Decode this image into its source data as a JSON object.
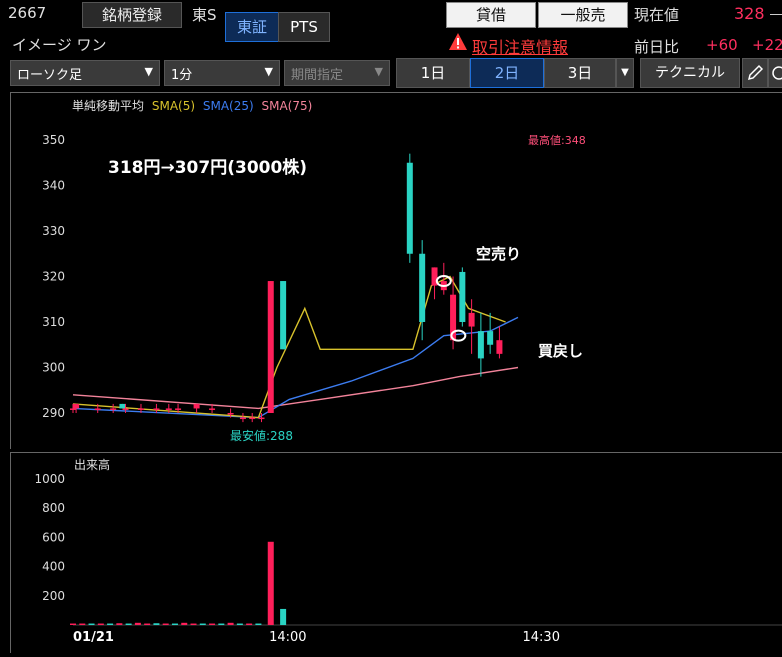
{
  "header": {
    "code": "2667",
    "name": "イメージ ワン",
    "register_label": "銘柄登録",
    "market_short": "東S",
    "tab_tse": "東証",
    "tab_pts": "PTS",
    "btn_lend": "貸借",
    "btn_general": "一般売",
    "warning": "取引注意情報",
    "price_label": "現在値",
    "price": "328",
    "change_label": "前日比",
    "change": "+60",
    "change_pct": "+22"
  },
  "toolbar": {
    "chart_type": "ローソク足",
    "interval": "1分",
    "period": "期間指定",
    "day1": "1日",
    "day2": "2日",
    "day3": "3日",
    "technical": "テクニカル"
  },
  "colors": {
    "up": "#ff1f5a",
    "down": "#2ad4c4",
    "sma5": "#d8c22c",
    "sma25": "#3c7cf0",
    "sma75": "#f2839a",
    "accent": "#1e6fd9"
  },
  "chart_data": [
    {
      "type": "candlestick",
      "title": "単純移動平均",
      "legend": [
        "SMA(5)",
        "SMA(25)",
        "SMA(75)"
      ],
      "ylim": [
        285,
        355
      ],
      "yticks": [
        290,
        300,
        310,
        320,
        330,
        340,
        350
      ],
      "xlim": [
        0,
        144
      ],
      "grid": false,
      "annotations": {
        "main_text": "318円→307円(3000株)",
        "short_sell": "空売り",
        "buy_back": "買戻し",
        "high": "最高値:348",
        "low": "最安値:288"
      },
      "candles": [
        {
          "x": 0,
          "o": 291,
          "h": 292,
          "l": 290,
          "c": 291
        },
        {
          "x": 1,
          "o": 291,
          "h": 292,
          "l": 290,
          "c": 292
        },
        {
          "x": 8,
          "o": 291,
          "h": 292,
          "l": 290,
          "c": 291
        },
        {
          "x": 13,
          "o": 291,
          "h": 292,
          "l": 290,
          "c": 291
        },
        {
          "x": 16,
          "o": 292,
          "h": 292,
          "l": 291,
          "c": 291
        },
        {
          "x": 17,
          "o": 291,
          "h": 292,
          "l": 290,
          "c": 291
        },
        {
          "x": 22,
          "o": 291,
          "h": 292,
          "l": 290,
          "c": 291
        },
        {
          "x": 27,
          "o": 291,
          "h": 292,
          "l": 290,
          "c": 291
        },
        {
          "x": 31,
          "o": 291,
          "h": 292,
          "l": 290,
          "c": 291
        },
        {
          "x": 34,
          "o": 291,
          "h": 292,
          "l": 290,
          "c": 291
        },
        {
          "x": 40,
          "o": 291,
          "h": 292,
          "l": 290,
          "c": 292
        },
        {
          "x": 45,
          "o": 291,
          "h": 292,
          "l": 290,
          "c": 291
        },
        {
          "x": 51,
          "o": 290,
          "h": 291,
          "l": 289,
          "c": 290
        },
        {
          "x": 55,
          "o": 289,
          "h": 290,
          "l": 288,
          "c": 289
        },
        {
          "x": 58,
          "o": 289,
          "h": 290,
          "l": 288,
          "c": 289
        },
        {
          "x": 61,
          "o": 289,
          "h": 290,
          "l": 288,
          "c": 289
        },
        {
          "x": 64,
          "o": 290,
          "h": 319,
          "l": 290,
          "c": 319
        },
        {
          "x": 68,
          "o": 319,
          "h": 319,
          "l": 304,
          "c": 304
        },
        {
          "x": 109,
          "o": 345,
          "h": 347,
          "l": 323,
          "c": 325
        },
        {
          "x": 113,
          "o": 325,
          "h": 328,
          "l": 306,
          "c": 310
        },
        {
          "x": 117,
          "o": 318,
          "h": 322,
          "l": 315,
          "c": 322
        },
        {
          "x": 120,
          "o": 317,
          "h": 323,
          "l": 316,
          "c": 319
        },
        {
          "x": 123,
          "o": 306,
          "h": 320,
          "l": 304,
          "c": 316
        },
        {
          "x": 126,
          "o": 321,
          "h": 322,
          "l": 309,
          "c": 310
        },
        {
          "x": 129,
          "o": 309,
          "h": 315,
          "l": 303,
          "c": 312
        },
        {
          "x": 132,
          "o": 308,
          "h": 312,
          "l": 298,
          "c": 302
        },
        {
          "x": 135,
          "o": 308,
          "h": 312,
          "l": 303,
          "c": 305
        },
        {
          "x": 138,
          "o": 303,
          "h": 309,
          "l": 302,
          "c": 306
        }
      ],
      "sma5": [
        [
          0,
          292
        ],
        [
          60,
          289
        ],
        [
          66,
          300
        ],
        [
          75,
          313
        ],
        [
          80,
          304
        ],
        [
          110,
          304
        ],
        [
          116,
          318
        ],
        [
          122,
          320
        ],
        [
          128,
          313
        ],
        [
          140,
          310
        ]
      ],
      "sma25": [
        [
          0,
          291
        ],
        [
          60,
          289
        ],
        [
          70,
          293
        ],
        [
          90,
          297
        ],
        [
          110,
          302
        ],
        [
          120,
          307
        ],
        [
          135,
          308
        ],
        [
          144,
          311
        ]
      ],
      "sma75": [
        [
          0,
          294
        ],
        [
          60,
          291
        ],
        [
          80,
          293
        ],
        [
          110,
          296
        ],
        [
          125,
          298
        ],
        [
          144,
          300
        ]
      ]
    },
    {
      "type": "bar",
      "title": "出来高",
      "ylim": [
        0,
        1100
      ],
      "yticks": [
        200,
        400,
        600,
        800,
        1000
      ],
      "xticks": [
        {
          "x": 0,
          "label": "01/21"
        },
        {
          "x": 68,
          "label": "14:00"
        },
        {
          "x": 150,
          "label": "14:30"
        }
      ],
      "bars": [
        {
          "x": 0,
          "v": 10,
          "up": true
        },
        {
          "x": 3,
          "v": 10,
          "up": true
        },
        {
          "x": 6,
          "v": 10,
          "up": false
        },
        {
          "x": 9,
          "v": 10,
          "up": true
        },
        {
          "x": 12,
          "v": 10,
          "up": false
        },
        {
          "x": 15,
          "v": 12,
          "up": true
        },
        {
          "x": 18,
          "v": 10,
          "up": false
        },
        {
          "x": 21,
          "v": 15,
          "up": true
        },
        {
          "x": 24,
          "v": 10,
          "up": true
        },
        {
          "x": 27,
          "v": 12,
          "up": false
        },
        {
          "x": 30,
          "v": 10,
          "up": true
        },
        {
          "x": 33,
          "v": 10,
          "up": false
        },
        {
          "x": 36,
          "v": 15,
          "up": true
        },
        {
          "x": 39,
          "v": 10,
          "up": true
        },
        {
          "x": 42,
          "v": 10,
          "up": false
        },
        {
          "x": 45,
          "v": 10,
          "up": true
        },
        {
          "x": 48,
          "v": 10,
          "up": false
        },
        {
          "x": 51,
          "v": 15,
          "up": true
        },
        {
          "x": 54,
          "v": 10,
          "up": false
        },
        {
          "x": 57,
          "v": 10,
          "up": true
        },
        {
          "x": 60,
          "v": 10,
          "up": false
        },
        {
          "x": 64,
          "v": 570,
          "up": true
        },
        {
          "x": 68,
          "v": 110,
          "up": false
        }
      ]
    }
  ]
}
